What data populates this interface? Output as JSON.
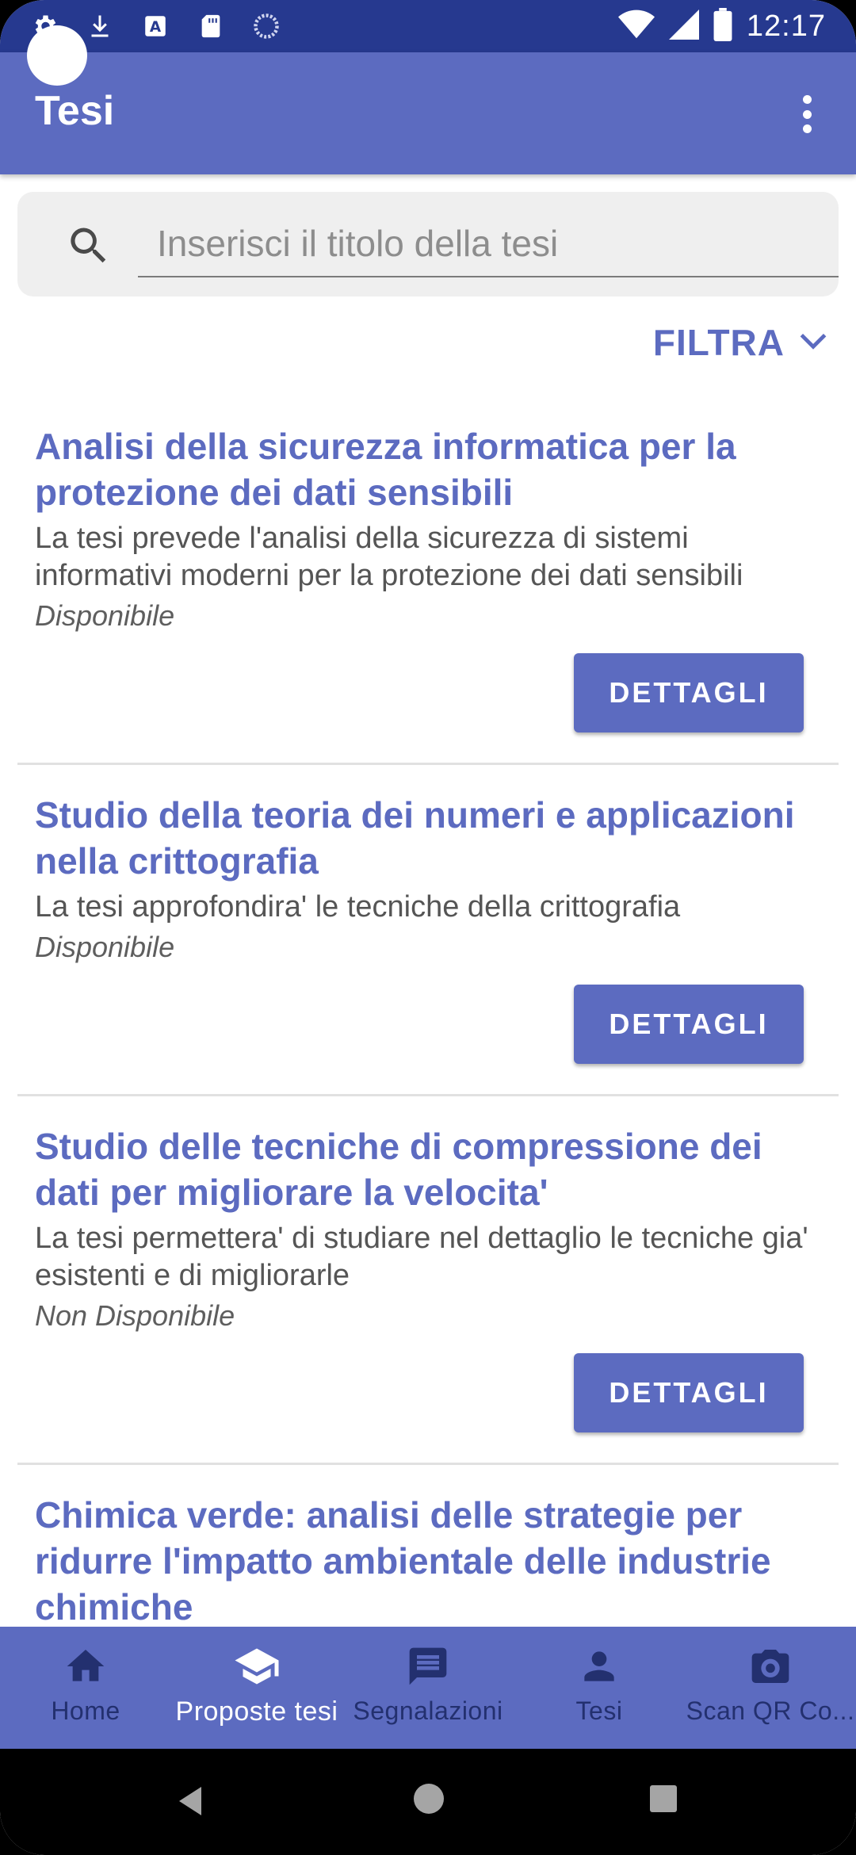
{
  "status_bar": {
    "time": "12:17",
    "icons_left": [
      "settings-icon",
      "download-icon",
      "accessibility-icon",
      "sd-card-icon",
      "loading-icon"
    ],
    "icons_right": [
      "wifi-icon",
      "signal-icon",
      "battery-icon"
    ]
  },
  "app_bar": {
    "title": "Tesi",
    "overflow_icon": "more-vert-icon"
  },
  "search": {
    "placeholder": "Inserisci il titolo della tesi",
    "value": ""
  },
  "filter": {
    "label": "FILTRA"
  },
  "theses": [
    {
      "title": "Analisi della sicurezza informatica per la protezione dei dati sensibili",
      "description": "La tesi prevede l'analisi della sicurezza di sistemi informativi moderni per la protezione dei dati sensibili",
      "status": "Disponibile",
      "button": "DETTAGLI"
    },
    {
      "title": "Studio della teoria dei numeri e applicazioni nella crittografia",
      "description": "La tesi approfondira' le tecniche della crittografia",
      "status": "Disponibile",
      "button": "DETTAGLI"
    },
    {
      "title": "Studio delle tecniche di compressione dei dati per migliorare la velocita'",
      "description": "La tesi permettera' di studiare nel dettaglio le tecniche gia' esistenti e di migliorarle",
      "status": "Non Disponibile",
      "button": "DETTAGLI"
    },
    {
      "title": "Chimica verde: analisi delle strategie per ridurre l'impatto ambientale delle industrie chimiche",
      "description": "",
      "status": "",
      "button": ""
    }
  ],
  "bottom_nav": {
    "items": [
      {
        "label": "Home",
        "icon": "home-icon",
        "active": false
      },
      {
        "label": "Proposte tesi",
        "icon": "school-icon",
        "active": true
      },
      {
        "label": "Segnalazioni",
        "icon": "message-icon",
        "active": false
      },
      {
        "label": "Tesi",
        "icon": "person-icon",
        "active": false
      },
      {
        "label": "Scan QR Co...",
        "icon": "camera-icon",
        "active": false
      }
    ]
  },
  "colors": {
    "primary": "#5c6bc0",
    "status_bar": "#26398f",
    "inactive_nav": "#23306f"
  }
}
